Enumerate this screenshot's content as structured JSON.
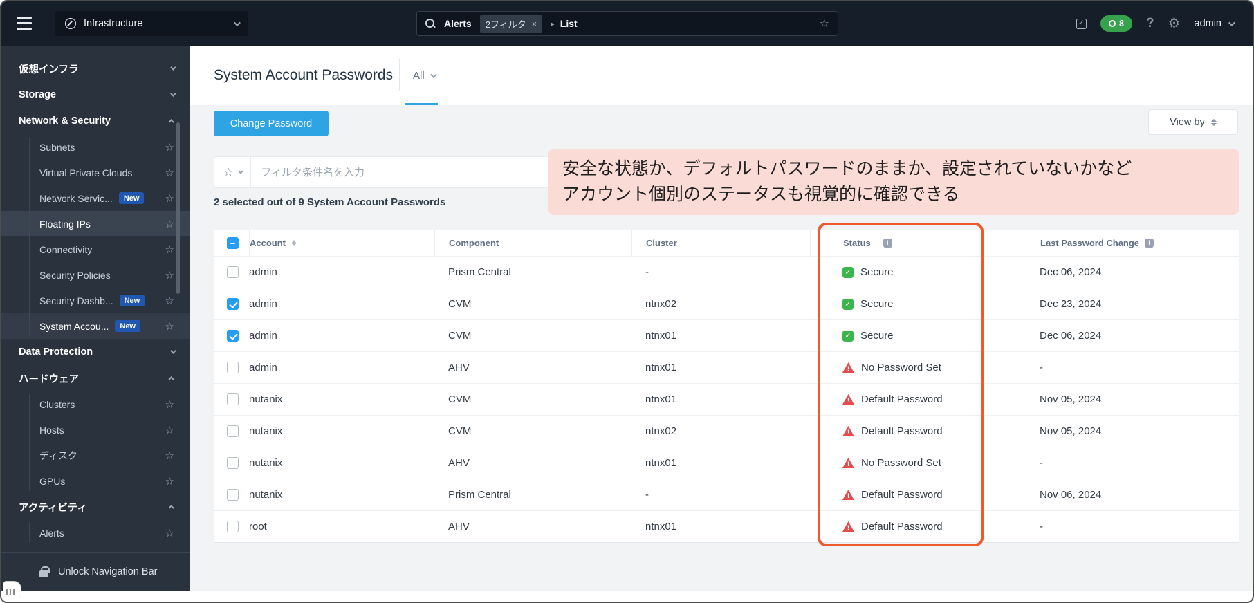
{
  "colors": {
    "accent_blue": "#2ea4e4",
    "secure_green": "#3cb64c",
    "warning_red": "#e64c4c",
    "highlight_orange": "#f0592b",
    "annotation_pink": "#fbdbd5",
    "new_badge_blue": "#2057b0",
    "tasks_pill_green": "#37a24c"
  },
  "topbar": {
    "app_menu_label": "Infrastructure",
    "search": {
      "context": "Alerts",
      "filter_chip": "2フィルタ",
      "chip_close": "×",
      "caret": "▸",
      "path_item": "List"
    },
    "right": {
      "tasks_count": "8",
      "help": "?",
      "user": "admin"
    }
  },
  "sidebar": {
    "groups": [
      {
        "label": "仮想インフラ",
        "expanded": false
      },
      {
        "label": "Storage",
        "expanded": false
      },
      {
        "label": "Network & Security",
        "expanded": true,
        "items": [
          {
            "label": "Subnets"
          },
          {
            "label": "Virtual Private Clouds"
          },
          {
            "label": "Network Servic...",
            "badge": "New"
          },
          {
            "label": "Floating IPs",
            "highlighted": true
          },
          {
            "label": "Connectivity"
          },
          {
            "label": "Security Policies"
          },
          {
            "label": "Security Dashb...",
            "badge": "New"
          },
          {
            "label": "System Accou...",
            "badge": "New",
            "selected": true
          }
        ]
      },
      {
        "label": "Data Protection",
        "expanded": false
      },
      {
        "label": "ハードウェア",
        "expanded": true,
        "items": [
          {
            "label": "Clusters"
          },
          {
            "label": "Hosts"
          },
          {
            "label": "ディスク"
          },
          {
            "label": "GPUs"
          }
        ]
      },
      {
        "label": "アクティビティ",
        "expanded": true,
        "items": [
          {
            "label": "Alerts"
          }
        ]
      }
    ],
    "unlock_label": "Unlock Navigation Bar"
  },
  "page": {
    "title": "System Account Passwords",
    "tab_label": "All",
    "change_password_label": "Change Password",
    "view_by_label": "View by",
    "filter_placeholder": "フィルタ条件名を入力",
    "selection_summary": "2 selected out of 9 System Account Passwords"
  },
  "annotation": {
    "line1": "安全な状態か、デフォルトパスワードのままか、設定されていないかなど",
    "line2": "アカウント個別のステータスも視覚的に確認できる"
  },
  "table": {
    "header_checkbox": "indeterminate",
    "columns": [
      {
        "label": "Account",
        "sort": true
      },
      {
        "label": "Component"
      },
      {
        "label": "Cluster"
      },
      {
        "label": "Status",
        "info": true
      },
      {
        "label": "Last Password Change",
        "info": true
      }
    ],
    "rows": [
      {
        "checked": false,
        "account": "admin",
        "component": "Prism Central",
        "cluster": "-",
        "status": "Secure",
        "status_type": "secure",
        "last_change": "Dec 06, 2024"
      },
      {
        "checked": true,
        "account": "admin",
        "component": "CVM",
        "cluster": "ntnx02",
        "status": "Secure",
        "status_type": "secure",
        "last_change": "Dec 23, 2024"
      },
      {
        "checked": true,
        "account": "admin",
        "component": "CVM",
        "cluster": "ntnx01",
        "status": "Secure",
        "status_type": "secure",
        "last_change": "Dec 06, 2024"
      },
      {
        "checked": false,
        "account": "admin",
        "component": "AHV",
        "cluster": "ntnx01",
        "status": "No Password Set",
        "status_type": "warning",
        "last_change": "-"
      },
      {
        "checked": false,
        "account": "nutanix",
        "component": "CVM",
        "cluster": "ntnx01",
        "status": "Default Password",
        "status_type": "warning",
        "last_change": "Nov 05, 2024"
      },
      {
        "checked": false,
        "account": "nutanix",
        "component": "CVM",
        "cluster": "ntnx02",
        "status": "Default Password",
        "status_type": "warning",
        "last_change": "Nov 05, 2024"
      },
      {
        "checked": false,
        "account": "nutanix",
        "component": "AHV",
        "cluster": "ntnx01",
        "status": "No Password Set",
        "status_type": "warning",
        "last_change": "-"
      },
      {
        "checked": false,
        "account": "nutanix",
        "component": "Prism Central",
        "cluster": "-",
        "status": "Default Password",
        "status_type": "warning",
        "last_change": "Nov 06, 2024"
      },
      {
        "checked": false,
        "account": "root",
        "component": "AHV",
        "cluster": "ntnx01",
        "status": "Default Password",
        "status_type": "warning",
        "last_change": "-"
      }
    ]
  }
}
